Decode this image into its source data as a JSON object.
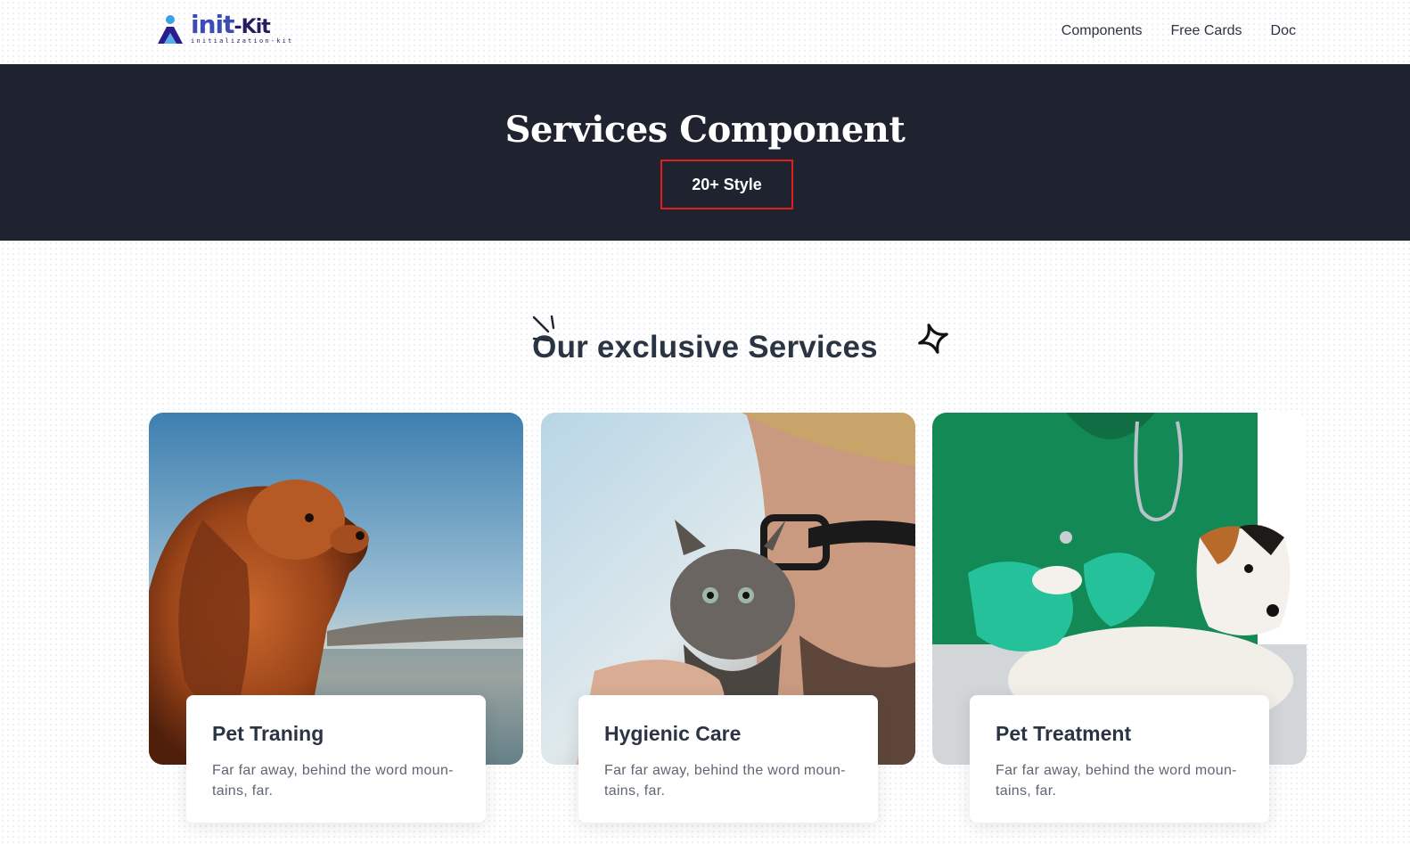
{
  "brand": {
    "logo_word": "init",
    "logo_kit": "-Kit",
    "logo_tagline": "initialization-kit"
  },
  "nav": {
    "items": [
      {
        "label": "Components"
      },
      {
        "label": "Free Cards"
      },
      {
        "label": "Doc"
      }
    ]
  },
  "hero": {
    "title": "Services Component",
    "badge": "20+ Style",
    "badge_border_color": "#e11d1d",
    "background": "#1f2330"
  },
  "section": {
    "title": "Our exclusive Services"
  },
  "cards": [
    {
      "title": "Pet Traning",
      "text": "Far far away, behind the word moun-tains, far.",
      "image": "dog-on-beach-photo"
    },
    {
      "title": "Hygienic Care",
      "text": "Far far away, behind the word moun-tains, far.",
      "image": "man-holding-kitten-photo"
    },
    {
      "title": "Pet Treatment",
      "text": "Far far away, behind the word moun-tains, far.",
      "image": "vet-examining-dog-photo"
    }
  ]
}
